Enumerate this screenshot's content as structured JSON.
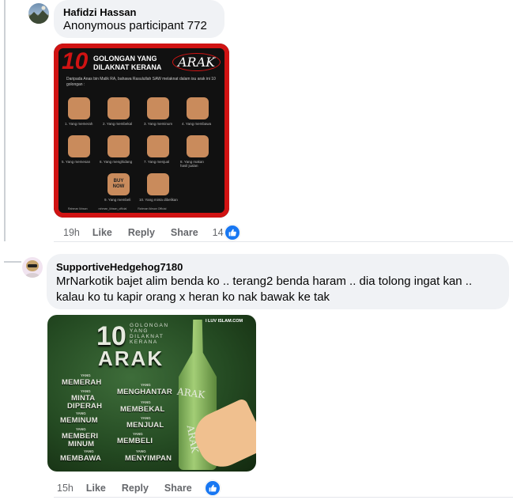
{
  "comments": [
    {
      "author": "Hafidzi Hassan",
      "text": "Anonymous participant 772",
      "time": "19h",
      "like": "Like",
      "reply": "Reply",
      "share": "Share",
      "reaction_count": "14",
      "image": {
        "big_number": "10",
        "title_line1": "GOLONGAN YANG",
        "title_line2": "DILAKNAT KERANA",
        "title_word": "ARAK",
        "subtitle": "Daripada Anas bin Malik RA, bahawa Rasulullah SAW melaknat dalam isu arak ini 10 golongan :",
        "captions": [
          "1. Yang memerah",
          "2. Yang membekal",
          "3. Yang meminum",
          "4. Yang membawa",
          "5. Yang memesan",
          "6. Yang menghidang",
          "7. Yang menjual",
          "8. Yang makan hasil jualan",
          "9. Yang membeli",
          "10. Yang minta dibelikan"
        ],
        "buy_icon_text": "BUY NOW",
        "footer": [
          "Rahman Ikhsan",
          "rahman_ikhsan_official",
          "Rahman Ikhsan Official"
        ]
      }
    },
    {
      "author": "SupportiveHedgehog7180",
      "text": "MrNarkotik bajet alim benda ko .. terang2 benda haram .. dia tolong ingat kan .. kalau ko tu kapir orang x heran ko nak bawak ke tak",
      "time": "15h",
      "like": "Like",
      "reply": "Reply",
      "share": "Share",
      "image": {
        "brand": "I LUV ISLAM.COM",
        "big_number": "10",
        "title_small": [
          "GOLONGAN",
          "YANG",
          "DILAKNAT",
          "KERANA"
        ],
        "title_word": "ARAK",
        "bottle_label": "ARAK",
        "bottle_label2": "ARAK",
        "yang": "YANG",
        "words": [
          "MEMERAH",
          "MENGHANTAR",
          "MINTA",
          "DIPERAH",
          "MEMBEKAL",
          "MEMINUM",
          "MENJUAL",
          "MEMBERI",
          "MINUM",
          "MEMBELI",
          "MEMBAWA",
          "MENYIMPAN"
        ]
      }
    }
  ],
  "colors": {
    "link": "#65676b",
    "like_blue": "#1877f2",
    "bubble": "#f0f2f5",
    "poster_red": "#d01313"
  },
  "icons": [
    "thumbs-up-icon"
  ]
}
